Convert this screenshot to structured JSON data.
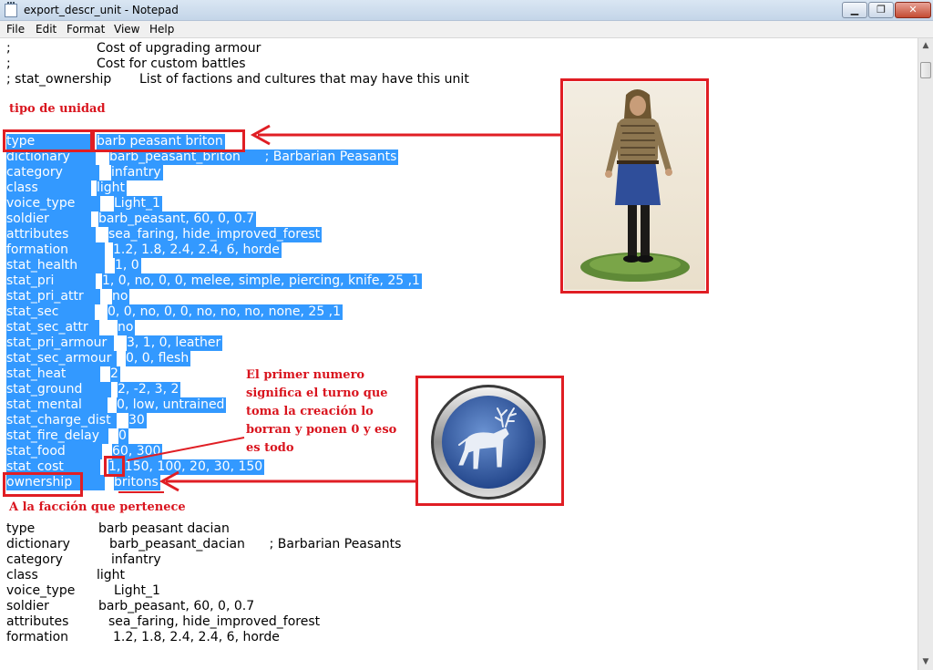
{
  "window": {
    "title": "export_descr_unit - Notepad",
    "min_label": "▁",
    "max_label": "❐",
    "close_label": "✕"
  },
  "menu": {
    "items": [
      "File",
      "Edit",
      "Format",
      "View",
      "Help"
    ]
  },
  "header_lines": [
    {
      "k": ";",
      "v": "Cost of upgrading armour"
    },
    {
      "k": ";",
      "v": "Cost for custom battles"
    },
    {
      "k": "; stat_ownership",
      "v": "List of factions and cultures that may have this unit"
    }
  ],
  "briton_unit": [
    {
      "k": "type",
      "v": "barb peasant briton"
    },
    {
      "k": "dictionary",
      "v": "barb_peasant_briton      ; Barbarian Peasants"
    },
    {
      "k": "category",
      "v": "infantry"
    },
    {
      "k": "class",
      "v": "light"
    },
    {
      "k": "voice_type",
      "v": "Light_1"
    },
    {
      "k": "soldier",
      "v": "barb_peasant, 60, 0, 0.7"
    },
    {
      "k": "attributes",
      "v": "sea_faring, hide_improved_forest"
    },
    {
      "k": "formation",
      "v": "1.2, 1.8, 2.4, 2.4, 6, horde"
    },
    {
      "k": "stat_health",
      "v": "1, 0"
    },
    {
      "k": "stat_pri",
      "v": "1, 0, no, 0, 0, melee, simple, piercing, knife, 25 ,1"
    },
    {
      "k": "stat_pri_attr",
      "v": "no"
    },
    {
      "k": "stat_sec",
      "v": "0, 0, no, 0, 0, no, no, no, none, 25 ,1"
    },
    {
      "k": "stat_sec_attr",
      "v": "no"
    },
    {
      "k": "stat_pri_armour",
      "v": "3, 1, 0, leather"
    },
    {
      "k": "stat_sec_armour",
      "v": "0, 0, flesh"
    },
    {
      "k": "stat_heat",
      "v": "2"
    },
    {
      "k": "stat_ground",
      "v": "2, -2, 3, 2"
    },
    {
      "k": "stat_mental",
      "v": "0, low, untrained"
    },
    {
      "k": "stat_charge_dist",
      "v": "30"
    },
    {
      "k": "stat_fire_delay",
      "v": "0"
    },
    {
      "k": "stat_food",
      "v": "60, 300"
    },
    {
      "k": "stat_cost",
      "v": "1, 150, 100, 20, 30, 150"
    },
    {
      "k": "ownership",
      "v": "britons"
    }
  ],
  "dacian_unit": [
    {
      "k": "type",
      "v": "barb peasant dacian"
    },
    {
      "k": "dictionary",
      "v": "barb_peasant_dacian      ; Barbarian Peasants"
    },
    {
      "k": "category",
      "v": "infantry"
    },
    {
      "k": "class",
      "v": "light"
    },
    {
      "k": "voice_type",
      "v": "Light_1"
    },
    {
      "k": "soldier",
      "v": "barb_peasant, 60, 0, 0.7"
    },
    {
      "k": "attributes",
      "v": "sea_faring, hide_improved_forest"
    },
    {
      "k": "formation",
      "v": "1.2, 1.8, 2.4, 2.4, 6, horde"
    }
  ],
  "annotations": {
    "unit_type": "tipo de unidad",
    "first_number": "El primer numero significa el turno que toma la creación lo borran y ponen 0 y eso es todo",
    "faction": "A la facción que pertenece"
  },
  "colors": {
    "selection": "#3399ff",
    "annotation_red": "#d9141e",
    "emblem_blue": "#2f5aa8"
  },
  "icons": [
    "notepad-icon",
    "peasant-unit-image",
    "stag-emblem-icon"
  ]
}
